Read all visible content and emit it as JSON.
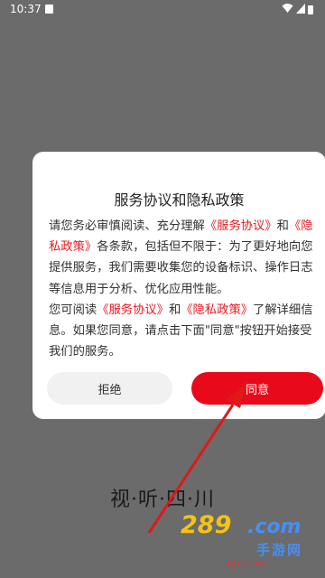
{
  "status_bar": {
    "time": "10:37"
  },
  "dialog": {
    "title": "服务协议和隐私政策",
    "p1": {
      "a": "请您务必审慎阅读、充分理解",
      "link1": "《服务协议》",
      "b": "和",
      "link2": "《隐私政策》",
      "c": "各条款，包括但不限于：为了更好地向您提供服务，我们需要收集您的设备标识、操作日志等信息用于分析、优化应用性能。"
    },
    "p2": {
      "a": "您可阅读",
      "link1": "《服务协议》",
      "b": "和",
      "link2": "《隐私政策》",
      "c": "了解详细信息。如果您同意，请点击下面\"同意\"按钮开始接受我们的服务。"
    },
    "reject_label": "拒绝",
    "agree_label": "同意"
  },
  "app_logo": "视·听·四·川",
  "watermark": {
    "num": "289",
    "com": ".com",
    "sub": "手游网",
    "php": "phpcms"
  }
}
